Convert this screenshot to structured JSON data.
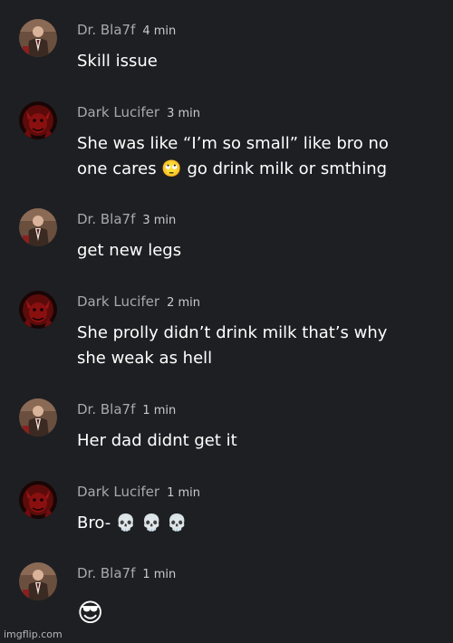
{
  "messages": [
    {
      "author": "Dr. Bla7f",
      "time": "4 min",
      "avatar": "person-in-suit-avatar",
      "lines": [
        "Skill issue"
      ]
    },
    {
      "author": "Dark Lucifer",
      "time": "3 min",
      "avatar": "red-demon-avatar",
      "lines": [
        "She was like “I’m so small” like bro no",
        "one cares 🙄 go drink milk or smthing"
      ]
    },
    {
      "author": "Dr. Bla7f",
      "time": "3 min",
      "avatar": "person-in-suit-avatar",
      "lines": [
        "get new legs"
      ]
    },
    {
      "author": "Dark Lucifer",
      "time": "2 min",
      "avatar": "red-demon-avatar",
      "lines": [
        "She prolly didn’t drink milk that’s why",
        "she weak as hell"
      ]
    },
    {
      "author": "Dr. Bla7f",
      "time": "1 min",
      "avatar": "person-in-suit-avatar",
      "lines": [
        "Her dad didnt get it"
      ]
    },
    {
      "author": "Dark Lucifer",
      "time": "1 min",
      "avatar": "red-demon-avatar",
      "lines": [
        "Bro- 💀 💀 💀"
      ]
    },
    {
      "author": "Dr. Bla7f",
      "time": "1 min",
      "avatar": "person-in-suit-avatar",
      "lines": [
        "😎"
      ]
    }
  ],
  "watermark": "imgflip.com",
  "colors": {
    "background": "#1e1f22",
    "author": "#a7a9ad",
    "time": "#c9cbcf",
    "text": "#ffffff"
  }
}
